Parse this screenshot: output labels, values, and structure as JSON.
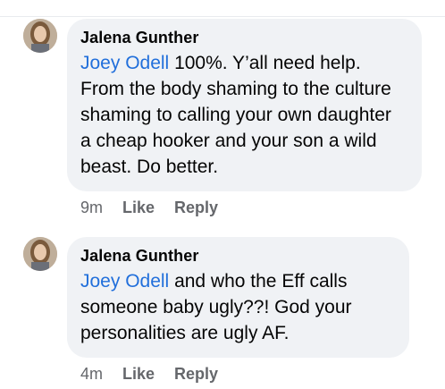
{
  "comments": [
    {
      "author": "Jalena Gunther",
      "mention": "Joey Odell",
      "text": "100%. Y’all need help. From the body shaming to the culture shaming to calling your own daughter a cheap hooker and your son a wild beast. Do better.",
      "time": "9m",
      "like_label": "Like",
      "reply_label": "Reply"
    },
    {
      "author": "Jalena Gunther",
      "mention": "Joey Odell",
      "text": "and who the Eff calls someone baby ugly??! God your personalities are ugly AF.",
      "time": "4m",
      "like_label": "Like",
      "reply_label": "Reply"
    }
  ],
  "colors": {
    "bubble": "#f0f2f5",
    "mention": "#216fdb",
    "meta": "#65676b",
    "text": "#050505"
  },
  "icons": {
    "avatar": "user-avatar-photo"
  }
}
